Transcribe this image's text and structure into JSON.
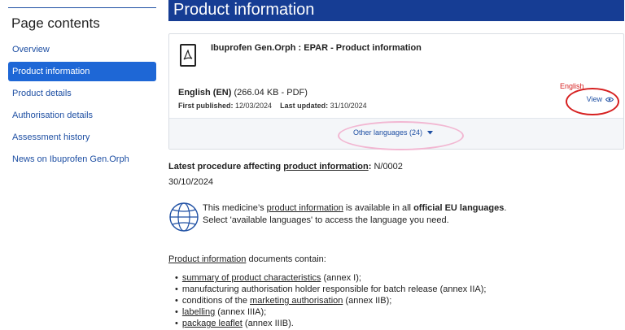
{
  "sidebar": {
    "title": "Page contents",
    "items": [
      {
        "label": "Overview",
        "active": false
      },
      {
        "label": "Product information",
        "active": true
      },
      {
        "label": "Product details",
        "active": false
      },
      {
        "label": "Authorisation details",
        "active": false
      },
      {
        "label": "Assessment history",
        "active": false
      },
      {
        "label": "News on Ibuprofen Gen.Orph",
        "active": false
      }
    ]
  },
  "header": {
    "title": "Product information"
  },
  "document": {
    "title": "Ibuprofen Gen.Orph : EPAR - Product information",
    "language": "English (EN)",
    "file_info": "(266.04 KB - PDF)",
    "first_published_label": "First published:",
    "first_published": "12/03/2024",
    "last_updated_label": "Last updated:",
    "last_updated": "31/10/2024",
    "view_label": "View",
    "other_languages": "Other languages (24)",
    "annotation": "English"
  },
  "latest": {
    "prefix": "Latest procedure affecting ",
    "link": "product information",
    "suffix": ": ",
    "procedure": "N/0002",
    "date": "30/10/2024"
  },
  "info": {
    "line1_a": "This medicine’s ",
    "line1_link": "product information",
    "line1_b": " is available in all ",
    "line1_bold": "official EU languages",
    "line1_end": ".",
    "line2": "Select 'available languages' to access the language you need."
  },
  "contents": {
    "heading_link": "Product information",
    "heading_rest": " documents contain:",
    "items": [
      {
        "link": "summary of product characteristics",
        "rest": " (annex I);"
      },
      {
        "link": "",
        "rest": "manufacturing authorisation holder responsible for batch release (annex IIA);"
      },
      {
        "pre": "conditions of the ",
        "link": "marketing authorisation",
        "rest": " (annex IIB);"
      },
      {
        "link": "labelling",
        "rest": " (annex IIIA);"
      },
      {
        "link": "package leaflet",
        "rest": " (annex IIIB)."
      }
    ]
  },
  "colors": {
    "brand": "#163d94",
    "link": "#1e4fa3",
    "active_nav": "#1e67d6",
    "annotation_red": "#d62020",
    "annotation_pink": "#f2b7d2"
  }
}
